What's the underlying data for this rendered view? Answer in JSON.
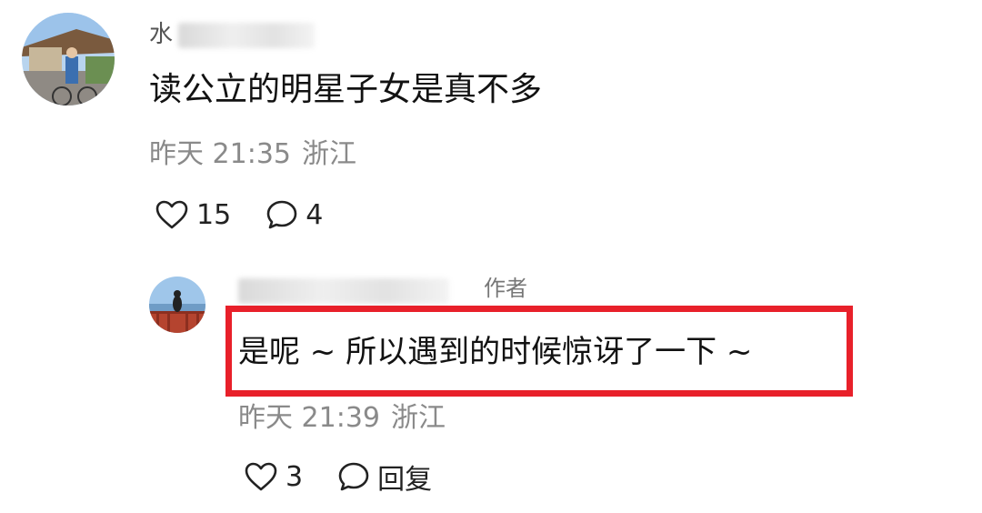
{
  "comments": [
    {
      "author_visible": "水",
      "text": "读公立的明星子女是真不多",
      "time": "昨天 21:35",
      "location": "浙江",
      "likes": "15",
      "replies": "4"
    }
  ],
  "reply": {
    "author_visible": "",
    "author_tag": "作者",
    "text": "是呢 ~ 所以遇到的时候惊讶了一下 ~",
    "time": "昨天 21:39",
    "location": "浙江",
    "likes": "3",
    "reply_label": "回复",
    "highlight_color": "#e8202a"
  },
  "icons": {
    "like": "heart-icon",
    "comment": "comment-bubble-icon"
  }
}
